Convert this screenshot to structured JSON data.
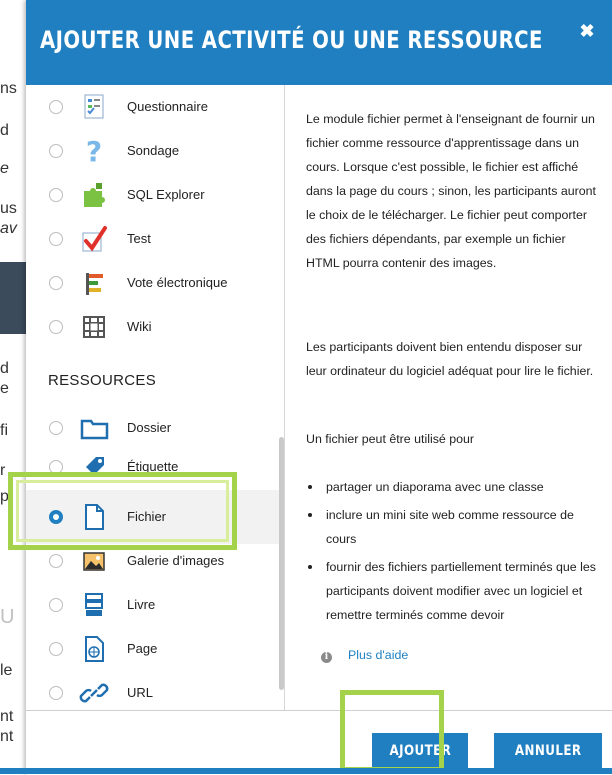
{
  "background": {
    "fragments": [
      "ns",
      "d",
      "e",
      "us",
      "av",
      "d",
      "e",
      "fi",
      "r",
      "p",
      "U",
      "le",
      "nt",
      "nt"
    ]
  },
  "modal": {
    "title": "AJOUTER UNE ACTIVITÉ OU UNE RESSOURCE",
    "close_icon": "close-icon",
    "activities": [
      {
        "label": "Questionnaire",
        "icon": "questionnaire-icon",
        "checked": false
      },
      {
        "label": "Sondage",
        "icon": "question-mark-icon",
        "checked": false
      },
      {
        "label": "SQL Explorer",
        "icon": "puzzle-icon",
        "checked": false
      },
      {
        "label": "Test",
        "icon": "checkmark-icon",
        "checked": false
      },
      {
        "label": "Vote électronique",
        "icon": "bar-chart-icon",
        "checked": false
      },
      {
        "label": "Wiki",
        "icon": "wiki-icon",
        "checked": false
      }
    ],
    "resources_title": "RESSOURCES",
    "resources": [
      {
        "label": "Dossier",
        "icon": "folder-icon",
        "checked": false
      },
      {
        "label": "Étiquette",
        "icon": "tag-icon",
        "checked": false
      },
      {
        "label": "Fichier",
        "icon": "file-icon",
        "checked": true
      },
      {
        "label": "Galerie d'images",
        "icon": "image-icon",
        "checked": false
      },
      {
        "label": "Livre",
        "icon": "book-icon",
        "checked": false
      },
      {
        "label": "Page",
        "icon": "page-icon",
        "checked": false
      },
      {
        "label": "URL",
        "icon": "link-icon",
        "checked": false
      }
    ],
    "description": {
      "p1": "Le module fichier permet à l'enseignant de fournir un fichier comme ressource d'apprentissage dans un cours. Lorsque c'est possible, le fichier est affiché dans la page du cours ; sinon, les participants auront le choix de le télécharger. Le fichier peut comporter des fichiers dépendants, par exemple un fichier HTML pourra contenir des images.",
      "p2": "Les participants doivent bien entendu disposer sur leur ordinateur du logiciel adéquat pour lire le fichier.",
      "p3": "Un fichier peut être utilisé pour",
      "bullets": [
        "partager un diaporama avec une classe",
        "inclure un mini site web comme ressource de cours",
        "fournir des fichiers partiellement terminés que les participants doivent modifier avec un logiciel et remettre terminés comme devoir"
      ],
      "help_link": "Plus d'aide"
    },
    "footer": {
      "add_label": "AJOUTER",
      "cancel_label": "ANNULER"
    }
  },
  "colors": {
    "header": "#1f7fc1",
    "highlight": "#a4d24a",
    "link": "#1f7fc1"
  }
}
